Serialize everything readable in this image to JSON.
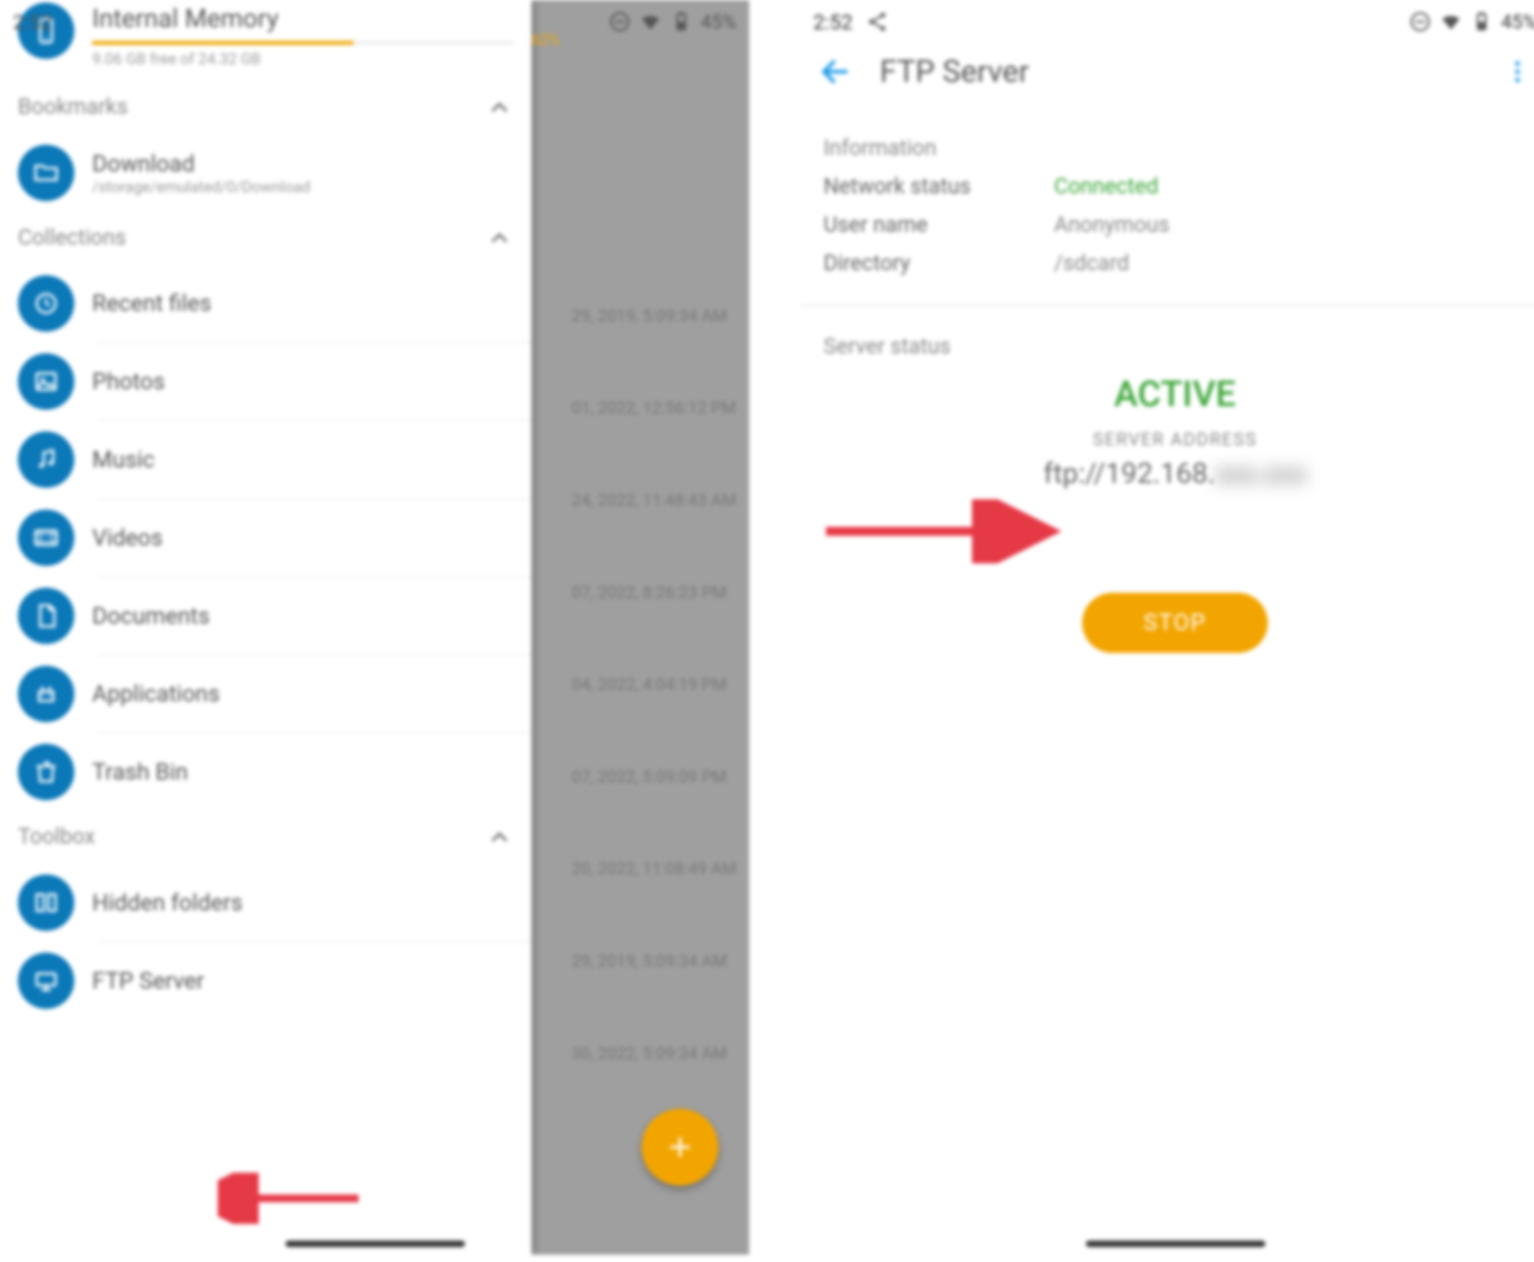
{
  "status": {
    "time": "2:52",
    "battery": "45%"
  },
  "left": {
    "memory": {
      "title": "Internal Memory",
      "percent": "62%",
      "fill_pct": 62,
      "sub": "9.06 GB free of 24.32 GB"
    },
    "sections": {
      "bookmarks": "Bookmarks",
      "collections": "Collections",
      "toolbox": "Toolbox"
    },
    "bookmark": {
      "title": "Download",
      "path": "/storage/emulated/0/Download"
    },
    "collections": [
      "Recent files",
      "Photos",
      "Music",
      "Videos",
      "Documents",
      "Applications",
      "Trash Bin"
    ],
    "toolbox": [
      "Hidden folders",
      "FTP Server"
    ],
    "bg_dates": [
      "29, 2019, 5:09:34 AM",
      "01, 2022, 12:56:12 PM",
      "24, 2022, 11:48:43 AM",
      "07, 2022, 8:26:23 PM",
      "04, 2022, 4:04:19 PM",
      "07, 2022, 5:09:09 PM",
      "20, 2022, 11:08:49 AM",
      "29, 2019, 5:09:34 AM",
      "30, 2022, 5:09:34 AM"
    ]
  },
  "right": {
    "title": "FTP Server",
    "info_header": "Information",
    "rows": {
      "network_label": "Network status",
      "network_value": "Connected",
      "user_label": "User name",
      "user_value": "Anonymous",
      "dir_label": "Directory",
      "dir_value": "/sdcard"
    },
    "server_status_header": "Server status",
    "active": "ACTIVE",
    "server_address_label": "SERVER ADDRESS",
    "address_visible": "ftp://192.168.",
    "address_hidden": "xxx.xxx",
    "stop": "STOP"
  }
}
